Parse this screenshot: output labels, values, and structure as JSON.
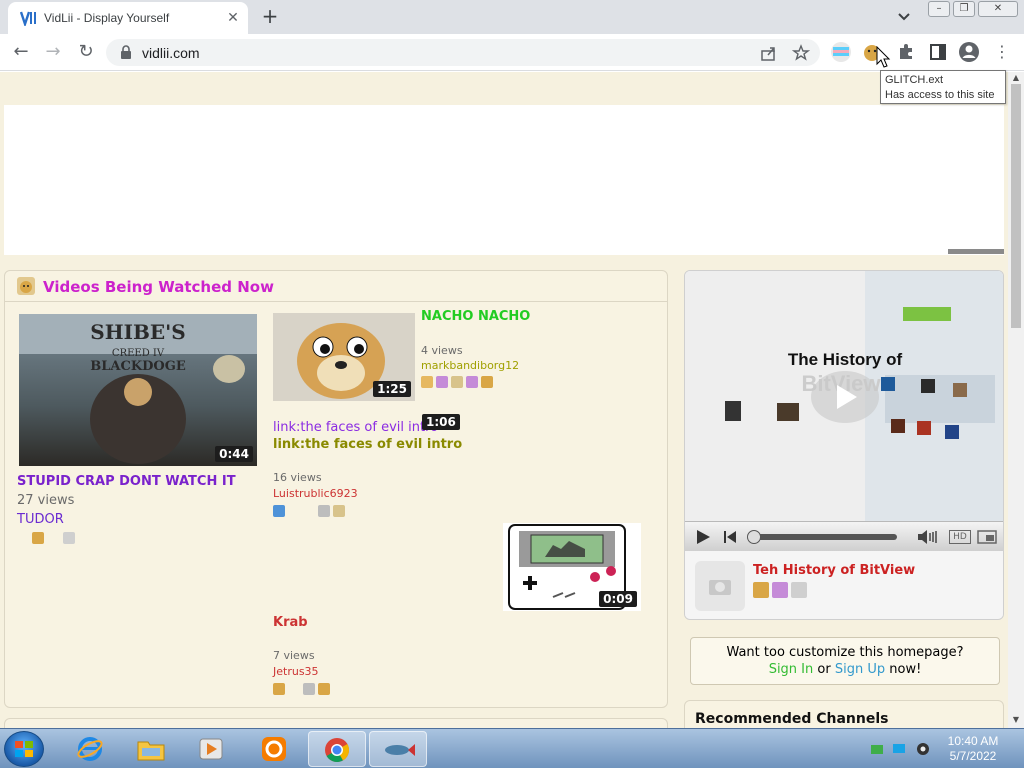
{
  "browser": {
    "tab_title": "VidLii - Display Yourself",
    "url": "vidlii.com",
    "tooltip_title": "GLITCH.ext",
    "tooltip_desc": "Has access to this site"
  },
  "section": {
    "title": "Videos Being Watched Now"
  },
  "videos": [
    {
      "title": "STUPID CRAP DONT WATCH IT",
      "views": "27 views",
      "user": "TUDOR",
      "duration": "0:44",
      "thumb_text": "SHIBE'S CREED IV BLACKDOGE",
      "title_color": "#7a22cc",
      "user_color": "#6a2bd1"
    },
    {
      "title": "NACHO NACHO",
      "views": "4 views",
      "user": "markbandiborg12",
      "duration": "1:25",
      "title_color": "#22cc22",
      "user_color": "#a0a000"
    },
    {
      "title": "link:the faces of evil intro",
      "broken_thumb_alt": "link:the faces of evil intro",
      "views": "16 views",
      "user": "Luistrublic6923",
      "duration": "1:06",
      "title_color": "#8a8a00",
      "user_color": "#cc3333"
    },
    {
      "title": "Krab",
      "views": "7 views",
      "user": "Jetrus35",
      "duration": "0:09",
      "title_color": "#cc3333",
      "user_color": "#cc3333"
    }
  ],
  "player": {
    "screen_text": "The History of",
    "screen_text_faint": "BitView",
    "video_title": "Teh History of BitView",
    "hd_label": "HD",
    "title_color": "#cc2222"
  },
  "customize": {
    "line1": "Want too customize this homepage?",
    "sign_in": "Sign In",
    "or": "or",
    "sign_up": "Sign Up",
    "now": "now!",
    "link_color": "#33bb33",
    "link2_color": "#3399cc"
  },
  "recommended": {
    "title": "Recommended Channels"
  },
  "taskbar": {
    "time": "10:40 AM",
    "date": "5/7/2022"
  }
}
